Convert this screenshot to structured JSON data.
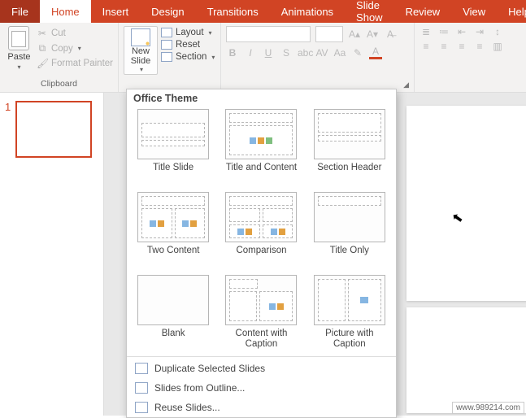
{
  "tabs": {
    "file": "File",
    "home": "Home",
    "insert": "Insert",
    "design": "Design",
    "transitions": "Transitions",
    "animations": "Animations",
    "slideshow": "Slide Show",
    "review": "Review",
    "view": "View",
    "help": "Help"
  },
  "ribbon": {
    "clipboard": {
      "label": "Clipboard",
      "paste": "Paste",
      "cut": "Cut",
      "copy": "Copy",
      "format_painter": "Format Painter"
    },
    "slides": {
      "new_slide": "New\nSlide",
      "layout": "Layout",
      "reset": "Reset",
      "section": "Section"
    }
  },
  "dropdown": {
    "header": "Office Theme",
    "layouts": [
      "Title Slide",
      "Title and Content",
      "Section Header",
      "Two Content",
      "Comparison",
      "Title Only",
      "Blank",
      "Content with Caption",
      "Picture with Caption"
    ],
    "duplicate": "Duplicate Selected Slides",
    "from_outline": "Slides from Outline...",
    "reuse": "Reuse Slides..."
  },
  "thumb_number": "1",
  "watermark": "www.989214.com"
}
